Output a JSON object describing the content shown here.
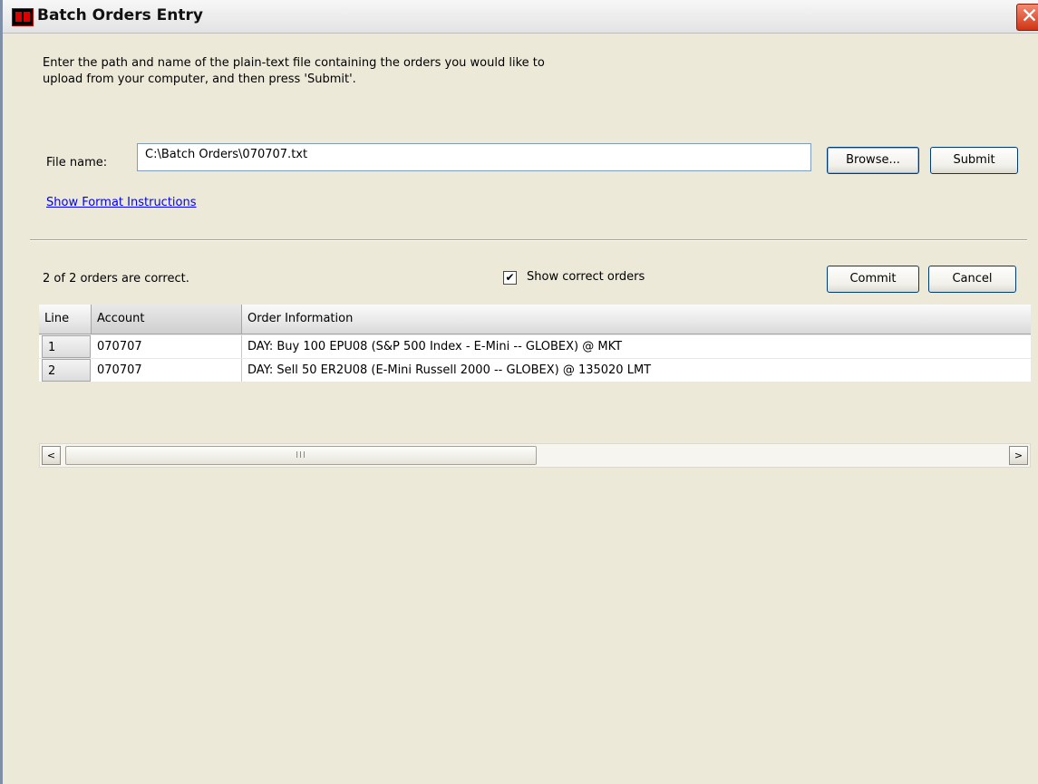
{
  "window": {
    "title": "Batch Orders Entry",
    "close_glyph": "✕"
  },
  "upload": {
    "instructions_line1": "Enter the path and name of the plain-text file containing the orders you would like to",
    "instructions_line2": "upload from your computer, and then press 'Submit'.",
    "file_label": "File name:",
    "file_value": "C:\\Batch Orders\\070707.txt",
    "browse_label": "Browse...",
    "submit_label": "Submit",
    "format_link": "Show Format Instructions"
  },
  "results": {
    "status": "2 of 2 orders are correct.",
    "show_correct_label": "Show correct orders",
    "show_correct_checked": true,
    "checkmark": "✔",
    "commit_label": "Commit",
    "cancel_label": "Cancel"
  },
  "table": {
    "columns": [
      "Line",
      "Account",
      "Order Information"
    ],
    "rows": [
      {
        "line": "1",
        "account": "070707",
        "info": "DAY: Buy 100 EPU08 (S&P 500 Index - E-Mini -- GLOBEX) @ MKT"
      },
      {
        "line": "2",
        "account": "070707",
        "info": "DAY: Sell 50 ER2U08 (E-Mini Russell 2000 -- GLOBEX) @ 135020 LMT"
      }
    ]
  },
  "scrollbar": {
    "left_arrow": "<",
    "right_arrow": ">",
    "thumb_grip": "III"
  }
}
